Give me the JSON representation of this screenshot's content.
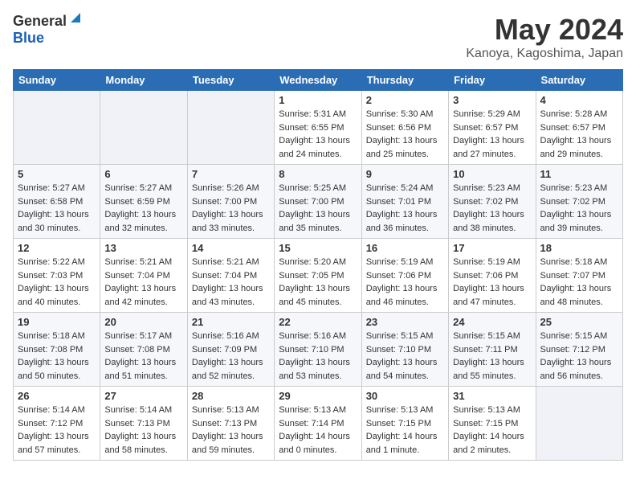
{
  "header": {
    "logo_general": "General",
    "logo_blue": "Blue",
    "month": "May 2024",
    "location": "Kanoya, Kagoshima, Japan"
  },
  "days_of_week": [
    "Sunday",
    "Monday",
    "Tuesday",
    "Wednesday",
    "Thursday",
    "Friday",
    "Saturday"
  ],
  "weeks": [
    [
      {
        "day": "",
        "info": ""
      },
      {
        "day": "",
        "info": ""
      },
      {
        "day": "",
        "info": ""
      },
      {
        "day": "1",
        "sunrise": "Sunrise: 5:31 AM",
        "sunset": "Sunset: 6:55 PM",
        "daylight": "Daylight: 13 hours and 24 minutes."
      },
      {
        "day": "2",
        "sunrise": "Sunrise: 5:30 AM",
        "sunset": "Sunset: 6:56 PM",
        "daylight": "Daylight: 13 hours and 25 minutes."
      },
      {
        "day": "3",
        "sunrise": "Sunrise: 5:29 AM",
        "sunset": "Sunset: 6:57 PM",
        "daylight": "Daylight: 13 hours and 27 minutes."
      },
      {
        "day": "4",
        "sunrise": "Sunrise: 5:28 AM",
        "sunset": "Sunset: 6:57 PM",
        "daylight": "Daylight: 13 hours and 29 minutes."
      }
    ],
    [
      {
        "day": "5",
        "sunrise": "Sunrise: 5:27 AM",
        "sunset": "Sunset: 6:58 PM",
        "daylight": "Daylight: 13 hours and 30 minutes."
      },
      {
        "day": "6",
        "sunrise": "Sunrise: 5:27 AM",
        "sunset": "Sunset: 6:59 PM",
        "daylight": "Daylight: 13 hours and 32 minutes."
      },
      {
        "day": "7",
        "sunrise": "Sunrise: 5:26 AM",
        "sunset": "Sunset: 7:00 PM",
        "daylight": "Daylight: 13 hours and 33 minutes."
      },
      {
        "day": "8",
        "sunrise": "Sunrise: 5:25 AM",
        "sunset": "Sunset: 7:00 PM",
        "daylight": "Daylight: 13 hours and 35 minutes."
      },
      {
        "day": "9",
        "sunrise": "Sunrise: 5:24 AM",
        "sunset": "Sunset: 7:01 PM",
        "daylight": "Daylight: 13 hours and 36 minutes."
      },
      {
        "day": "10",
        "sunrise": "Sunrise: 5:23 AM",
        "sunset": "Sunset: 7:02 PM",
        "daylight": "Daylight: 13 hours and 38 minutes."
      },
      {
        "day": "11",
        "sunrise": "Sunrise: 5:23 AM",
        "sunset": "Sunset: 7:02 PM",
        "daylight": "Daylight: 13 hours and 39 minutes."
      }
    ],
    [
      {
        "day": "12",
        "sunrise": "Sunrise: 5:22 AM",
        "sunset": "Sunset: 7:03 PM",
        "daylight": "Daylight: 13 hours and 40 minutes."
      },
      {
        "day": "13",
        "sunrise": "Sunrise: 5:21 AM",
        "sunset": "Sunset: 7:04 PM",
        "daylight": "Daylight: 13 hours and 42 minutes."
      },
      {
        "day": "14",
        "sunrise": "Sunrise: 5:21 AM",
        "sunset": "Sunset: 7:04 PM",
        "daylight": "Daylight: 13 hours and 43 minutes."
      },
      {
        "day": "15",
        "sunrise": "Sunrise: 5:20 AM",
        "sunset": "Sunset: 7:05 PM",
        "daylight": "Daylight: 13 hours and 45 minutes."
      },
      {
        "day": "16",
        "sunrise": "Sunrise: 5:19 AM",
        "sunset": "Sunset: 7:06 PM",
        "daylight": "Daylight: 13 hours and 46 minutes."
      },
      {
        "day": "17",
        "sunrise": "Sunrise: 5:19 AM",
        "sunset": "Sunset: 7:06 PM",
        "daylight": "Daylight: 13 hours and 47 minutes."
      },
      {
        "day": "18",
        "sunrise": "Sunrise: 5:18 AM",
        "sunset": "Sunset: 7:07 PM",
        "daylight": "Daylight: 13 hours and 48 minutes."
      }
    ],
    [
      {
        "day": "19",
        "sunrise": "Sunrise: 5:18 AM",
        "sunset": "Sunset: 7:08 PM",
        "daylight": "Daylight: 13 hours and 50 minutes."
      },
      {
        "day": "20",
        "sunrise": "Sunrise: 5:17 AM",
        "sunset": "Sunset: 7:08 PM",
        "daylight": "Daylight: 13 hours and 51 minutes."
      },
      {
        "day": "21",
        "sunrise": "Sunrise: 5:16 AM",
        "sunset": "Sunset: 7:09 PM",
        "daylight": "Daylight: 13 hours and 52 minutes."
      },
      {
        "day": "22",
        "sunrise": "Sunrise: 5:16 AM",
        "sunset": "Sunset: 7:10 PM",
        "daylight": "Daylight: 13 hours and 53 minutes."
      },
      {
        "day": "23",
        "sunrise": "Sunrise: 5:15 AM",
        "sunset": "Sunset: 7:10 PM",
        "daylight": "Daylight: 13 hours and 54 minutes."
      },
      {
        "day": "24",
        "sunrise": "Sunrise: 5:15 AM",
        "sunset": "Sunset: 7:11 PM",
        "daylight": "Daylight: 13 hours and 55 minutes."
      },
      {
        "day": "25",
        "sunrise": "Sunrise: 5:15 AM",
        "sunset": "Sunset: 7:12 PM",
        "daylight": "Daylight: 13 hours and 56 minutes."
      }
    ],
    [
      {
        "day": "26",
        "sunrise": "Sunrise: 5:14 AM",
        "sunset": "Sunset: 7:12 PM",
        "daylight": "Daylight: 13 hours and 57 minutes."
      },
      {
        "day": "27",
        "sunrise": "Sunrise: 5:14 AM",
        "sunset": "Sunset: 7:13 PM",
        "daylight": "Daylight: 13 hours and 58 minutes."
      },
      {
        "day": "28",
        "sunrise": "Sunrise: 5:13 AM",
        "sunset": "Sunset: 7:13 PM",
        "daylight": "Daylight: 13 hours and 59 minutes."
      },
      {
        "day": "29",
        "sunrise": "Sunrise: 5:13 AM",
        "sunset": "Sunset: 7:14 PM",
        "daylight": "Daylight: 14 hours and 0 minutes."
      },
      {
        "day": "30",
        "sunrise": "Sunrise: 5:13 AM",
        "sunset": "Sunset: 7:15 PM",
        "daylight": "Daylight: 14 hours and 1 minute."
      },
      {
        "day": "31",
        "sunrise": "Sunrise: 5:13 AM",
        "sunset": "Sunset: 7:15 PM",
        "daylight": "Daylight: 14 hours and 2 minutes."
      },
      {
        "day": "",
        "info": ""
      }
    ]
  ]
}
